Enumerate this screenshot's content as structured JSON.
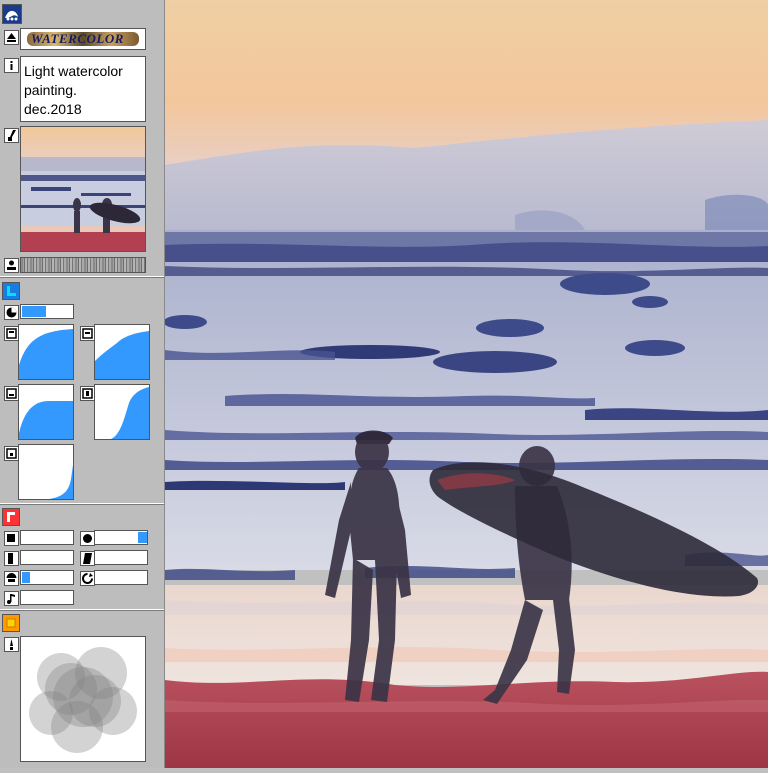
{
  "header": {
    "logo_text": "WATERCOLOR"
  },
  "description": {
    "line1": "Light watercolor",
    "line2": "painting.",
    "line3": "dec.2018"
  },
  "sliders": {
    "blend": 0.35,
    "size": 0.0,
    "dot": 0.85,
    "edge": 0.0,
    "shape": 0.0,
    "tone": 0.15,
    "rotate": 0.0,
    "texture": 0.0
  },
  "colors": {
    "accent_blue": "#3399ff",
    "section_blue": "#1a7be0",
    "section_red": "#ff3333",
    "section_orange": "#ff9900"
  },
  "icons": [
    "water-logo-icon",
    "arrow-up-icon",
    "info-icon",
    "brush-icon",
    "person-icon",
    "pie-icon",
    "curve-icon",
    "circle-icon",
    "shape-icon",
    "rotate-icon",
    "music-icon"
  ]
}
